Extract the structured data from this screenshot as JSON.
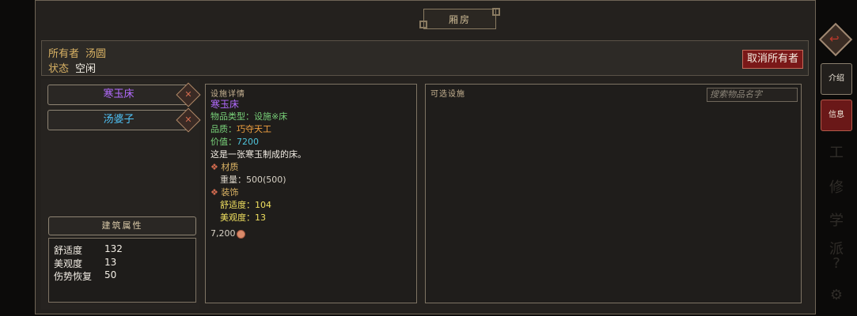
{
  "title": "厢房",
  "info": {
    "owner_label": "所有者",
    "owner_value": "汤圆",
    "status_label": "状态",
    "status_value": "空闲",
    "cancel_owner_label": "取消所有者"
  },
  "items": [
    {
      "label": "寒玉床",
      "color": "#b36bff"
    },
    {
      "label": "汤婆子",
      "color": "#4fc3f7"
    }
  ],
  "building_attrs": {
    "header": "建筑属性",
    "rows": [
      {
        "name": "舒适度",
        "value": "132"
      },
      {
        "name": "美观度",
        "value": "13"
      },
      {
        "name": "伤势恢复",
        "value": "50"
      }
    ]
  },
  "detail": {
    "header": "设施详情",
    "name": "寒玉床",
    "type_line": "物品类型：设施※床",
    "quality_label": "品质：",
    "quality_value": "巧夺天工",
    "value_label": "价值：",
    "value_value": "7200",
    "description": "这是一张寒玉制成的床。",
    "material_section": "材质",
    "weight_line": "重量：500(500)",
    "decor_section": "装饰",
    "comfort_line": "舒适度：104",
    "beauty_line": "美观度：13",
    "price": "7,200"
  },
  "available": {
    "header": "可选设施",
    "search_placeholder": "搜索物品名字"
  },
  "sidebar": {
    "intro_label": "介绍",
    "info_label": "信息",
    "faint_icons": [
      "工",
      "修",
      "学",
      "派",
      "?",
      "⚙"
    ]
  }
}
